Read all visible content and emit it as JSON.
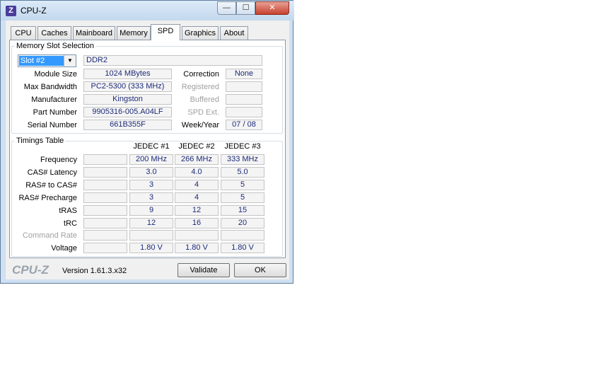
{
  "window": {
    "title": "CPU-Z",
    "icon_letter": "Z"
  },
  "caption": {
    "minimize": "—",
    "maximize": "☐",
    "close": "✕"
  },
  "tabs": [
    {
      "label": "CPU"
    },
    {
      "label": "Caches"
    },
    {
      "label": "Mainboard"
    },
    {
      "label": "Memory"
    },
    {
      "label": "SPD"
    },
    {
      "label": "Graphics"
    },
    {
      "label": "About"
    }
  ],
  "memory_slot": {
    "legend": "Memory Slot Selection",
    "slot": "Slot #2",
    "type": "DDR2",
    "fields": {
      "module_size": {
        "label": "Module Size",
        "value": "1024 MBytes"
      },
      "max_bandwidth": {
        "label": "Max Bandwidth",
        "value": "PC2-5300 (333 MHz)"
      },
      "manufacturer": {
        "label": "Manufacturer",
        "value": "Kingston"
      },
      "part_number": {
        "label": "Part Number",
        "value": "9905316-005.A04LF"
      },
      "serial_number": {
        "label": "Serial Number",
        "value": "661B355F"
      },
      "correction": {
        "label": "Correction",
        "value": "None"
      },
      "registered": {
        "label": "Registered",
        "value": ""
      },
      "buffered": {
        "label": "Buffered",
        "value": ""
      },
      "spd_ext": {
        "label": "SPD Ext.",
        "value": ""
      },
      "week_year": {
        "label": "Week/Year",
        "value": "07 / 08"
      }
    }
  },
  "timings": {
    "legend": "Timings Table",
    "columns": [
      "JEDEC #1",
      "JEDEC #2",
      "JEDEC #3"
    ],
    "rows": [
      {
        "label": "Frequency",
        "values": [
          "200 MHz",
          "266 MHz",
          "333 MHz"
        ]
      },
      {
        "label": "CAS# Latency",
        "values": [
          "3.0",
          "4.0",
          "5.0"
        ]
      },
      {
        "label": "RAS# to CAS#",
        "values": [
          "3",
          "4",
          "5"
        ]
      },
      {
        "label": "RAS# Precharge",
        "values": [
          "3",
          "4",
          "5"
        ]
      },
      {
        "label": "tRAS",
        "values": [
          "9",
          "12",
          "15"
        ]
      },
      {
        "label": "tRC",
        "values": [
          "12",
          "16",
          "20"
        ]
      },
      {
        "label": "Command Rate",
        "values": [
          "",
          "",
          ""
        ]
      },
      {
        "label": "Voltage",
        "values": [
          "1.80 V",
          "1.80 V",
          "1.80 V"
        ]
      }
    ]
  },
  "footer": {
    "brand": "CPU-Z",
    "version": "Version 1.61.3.x32",
    "validate": "Validate",
    "ok": "OK"
  }
}
